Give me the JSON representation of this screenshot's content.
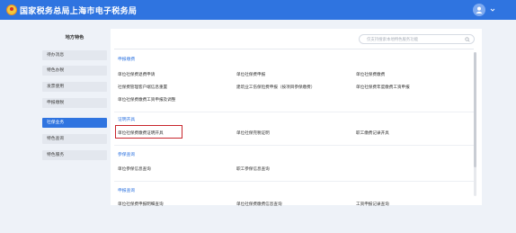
{
  "header": {
    "title": "国家税务总局上海市电子税务局"
  },
  "sidebar": {
    "heading": "地方特色",
    "items": [
      "待办消息",
      "特色办税",
      "发票使用",
      "申报缴税",
      "社保业务",
      "特色查询",
      "特色服务"
    ],
    "active": "社保业务"
  },
  "search": {
    "placeholder": "仅支持搜索本地特色服务功能"
  },
  "sections": [
    {
      "title": "申报缴费",
      "rows": [
        [
          "单位社保费退费申请",
          "单位社保费申报",
          "单位社保费缴费"
        ],
        [
          "社保费管理客户端信息重置",
          "建筑业工伤保险费申报（按项目参保缴费）",
          "单位社保费年度缴费工资申报"
        ],
        [
          "单位社保费缴费工资申报及调整"
        ]
      ]
    },
    {
      "title": "证明开具",
      "rows": [
        [
          "单位社保费缴费证明开具",
          "单位社保完税证明",
          "职工缴费记录开具"
        ]
      ]
    },
    {
      "title": "参保查询",
      "rows": [
        [
          "单位参保信息查询",
          "职工参保信息查询"
        ]
      ]
    },
    {
      "title": "申报查询",
      "rows": [
        [
          "单位社保费申报明细查询",
          "单位社保费缴费信息查询",
          "工资申报记录查询"
        ]
      ]
    }
  ],
  "colors": {
    "brand": "#2f74e0",
    "highlight": "#c8262c"
  },
  "icons": {
    "logo": "tax-bureau-emblem-icon",
    "user": "user-avatar-icon",
    "caret": "chevron-down-icon",
    "search": "search-icon"
  }
}
